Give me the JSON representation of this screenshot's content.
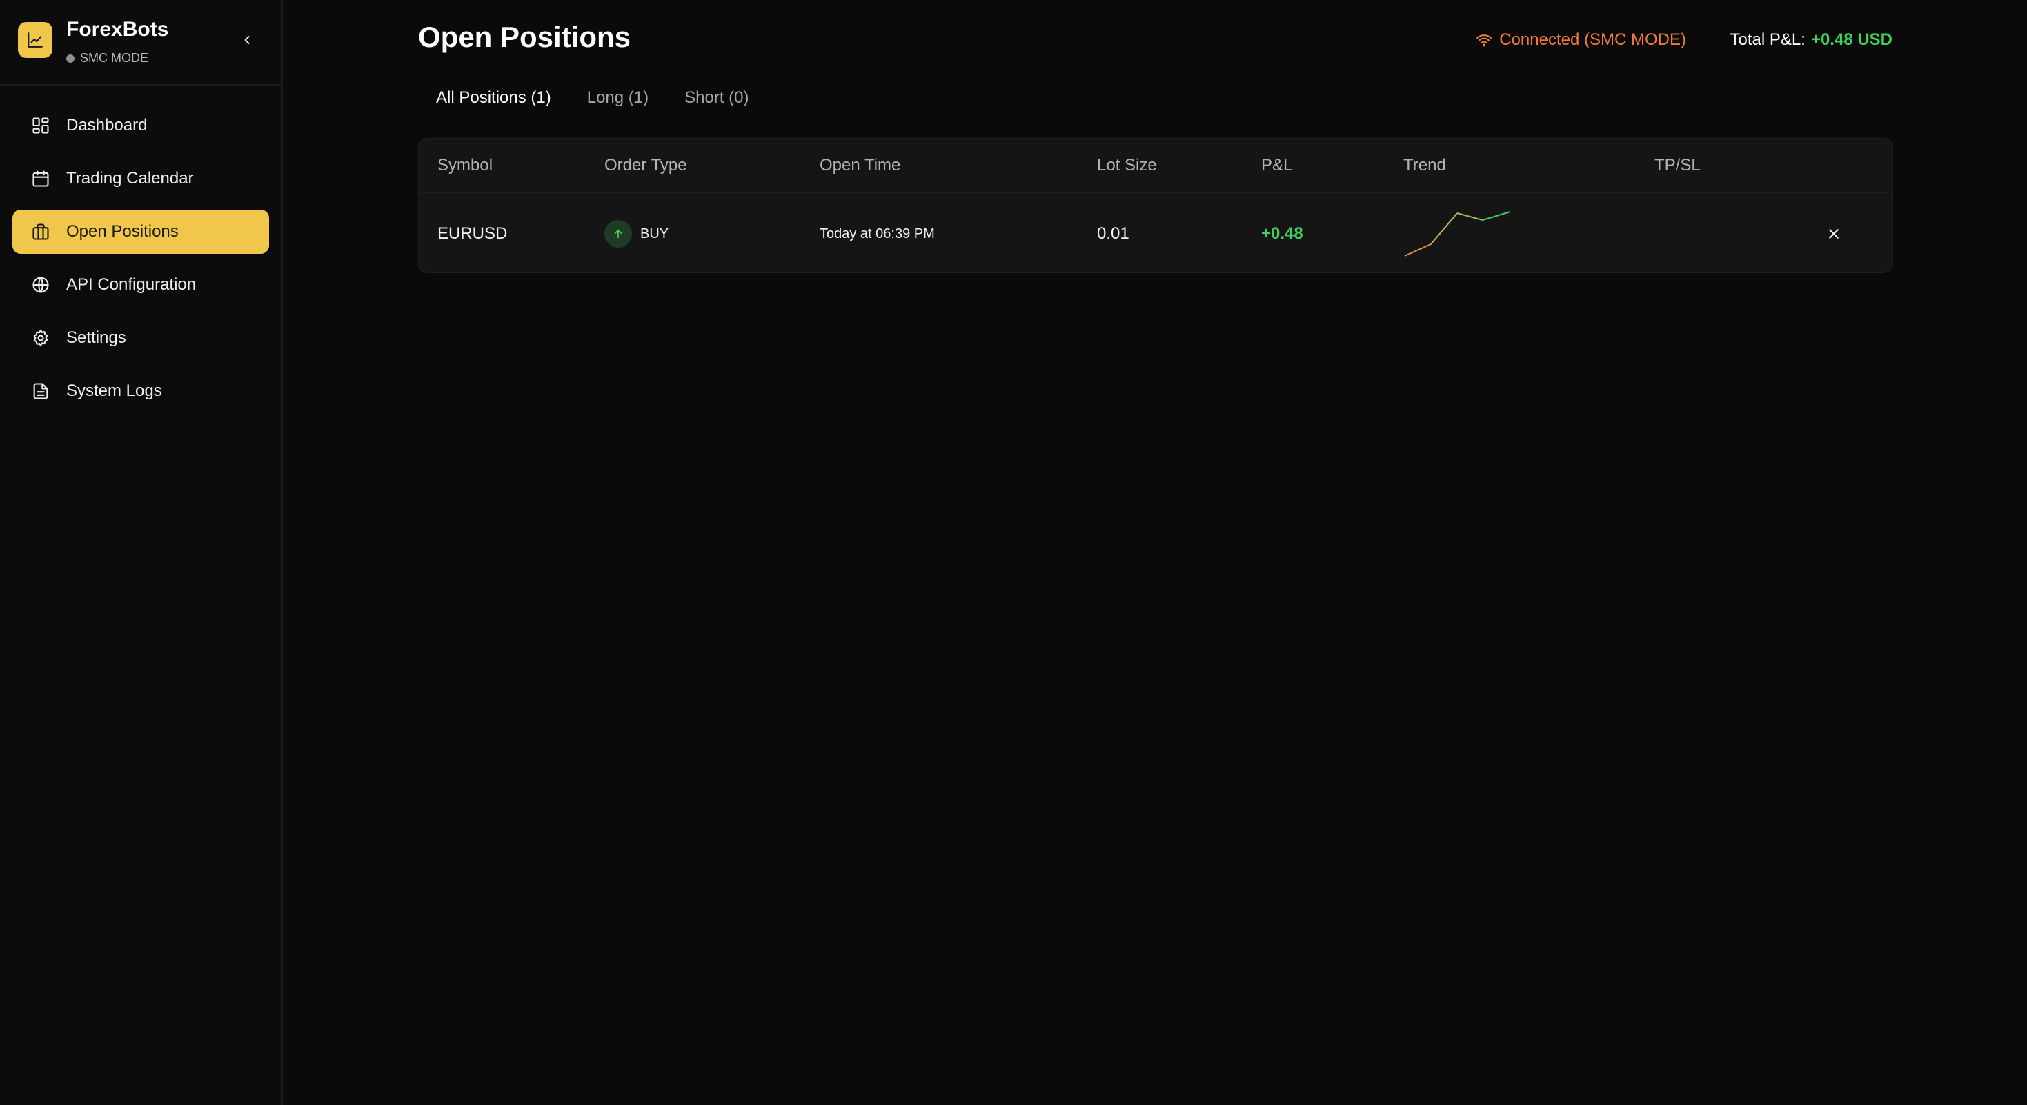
{
  "brand": {
    "name": "ForexBots",
    "mode": "SMC MODE"
  },
  "sidebar": {
    "items": [
      {
        "label": "Dashboard",
        "icon": "dashboard-icon"
      },
      {
        "label": "Trading Calendar",
        "icon": "calendar-icon"
      },
      {
        "label": "Open Positions",
        "icon": "briefcase-icon",
        "active": true
      },
      {
        "label": "API Configuration",
        "icon": "globe-icon"
      },
      {
        "label": "Settings",
        "icon": "gear-icon"
      },
      {
        "label": "System Logs",
        "icon": "document-icon"
      }
    ]
  },
  "header": {
    "title": "Open Positions",
    "status": "Connected (SMC MODE)",
    "total_pnl_label": "Total P&L:",
    "total_pnl_value": "+0.48 USD"
  },
  "tabs": [
    {
      "label": "All Positions (1)",
      "active": true
    },
    {
      "label": "Long (1)"
    },
    {
      "label": "Short (0)"
    }
  ],
  "table": {
    "columns": [
      "Symbol",
      "Order Type",
      "Open Time",
      "Lot Size",
      "P&L",
      "Trend",
      "TP/SL"
    ],
    "rows": [
      {
        "symbol": "EURUSD",
        "order_type": "BUY",
        "open_time": "Today at 06:39 PM",
        "lot_size": "0.01",
        "pnl": "+0.48",
        "tp_sl": ""
      }
    ]
  },
  "colors": {
    "accent": "#f0c74a",
    "positive": "#3fcf5a",
    "status": "#f07c3a",
    "background": "#0a0a0b"
  }
}
